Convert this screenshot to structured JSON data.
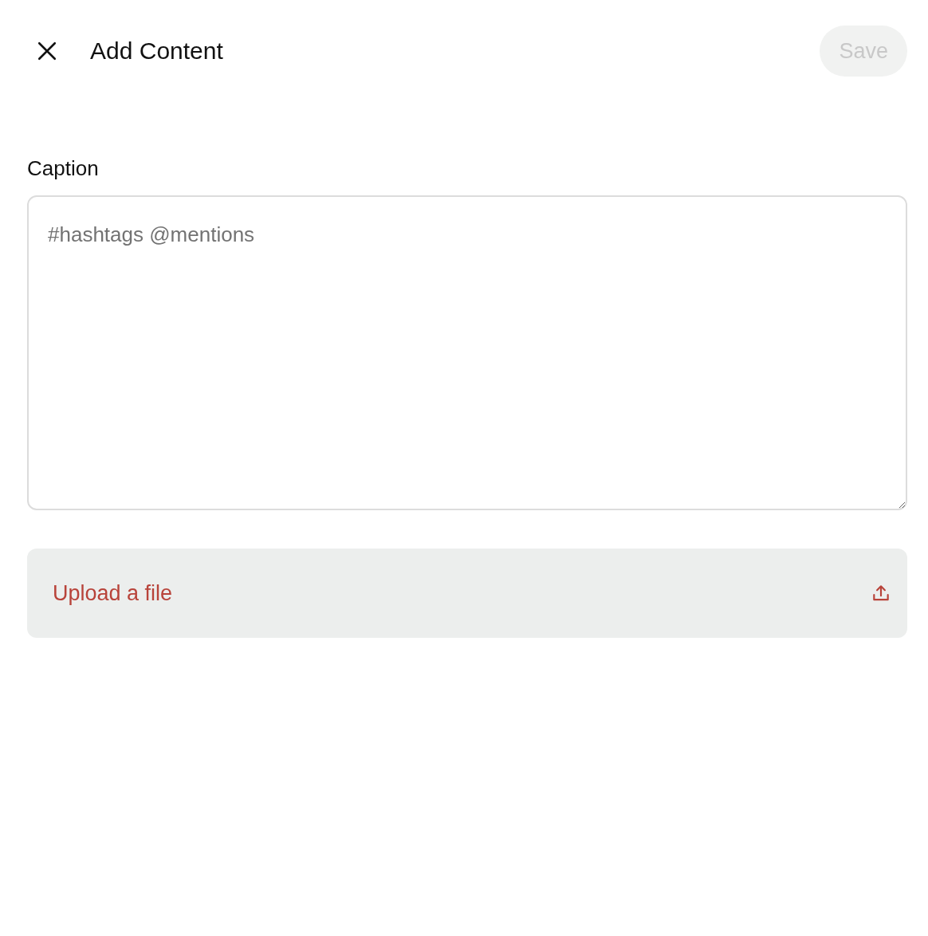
{
  "header": {
    "title": "Add Content",
    "save": {
      "label": "Save",
      "disabled": true
    }
  },
  "caption": {
    "label": "Caption",
    "placeholder": "#hashtags @mentions"
  },
  "upload": {
    "label": "Upload a file"
  }
}
